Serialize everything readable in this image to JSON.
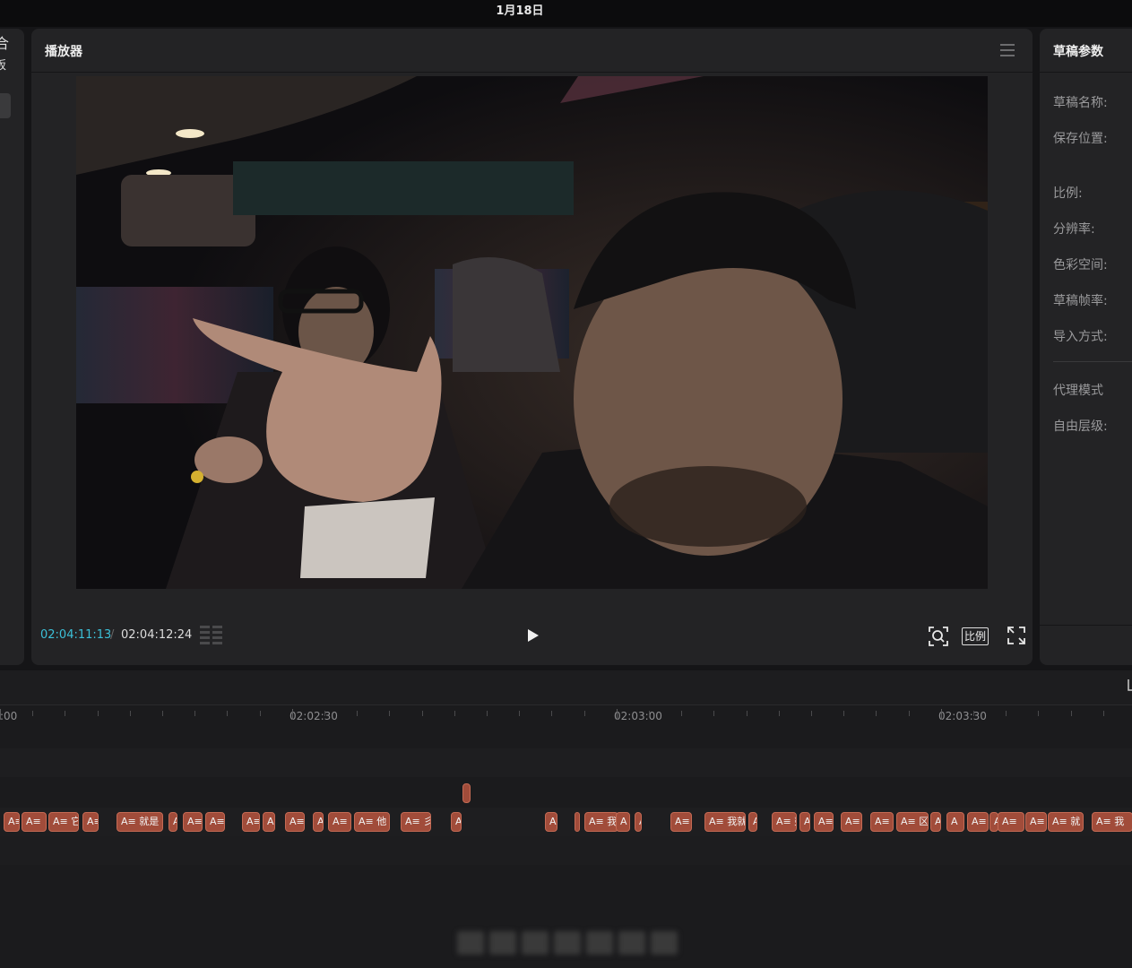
{
  "topbar": {
    "date": "1月18日"
  },
  "left_panel": {
    "glyph": "合",
    "label": "板"
  },
  "player": {
    "title": "播放器",
    "current_time": "02:04:11:13",
    "separator": "/",
    "total_time": "02:04:12:24",
    "ratio_label": "比例",
    "icons": [
      "menu-icon",
      "grid-icon",
      "play-icon",
      "scan-zoom-icon",
      "ratio-icon",
      "fullscreen-icon"
    ]
  },
  "params": {
    "title": "草稿参数",
    "rows": [
      "草稿名称:",
      "保存位置:",
      "比例:",
      "分辨率:",
      "色彩空间:",
      "草稿帧率:",
      "导入方式:",
      "代理模式",
      "自由层级:"
    ]
  },
  "timeline": {
    "ruler_labels": [
      ":00",
      "02:02:30",
      "02:03:00",
      "02:03:30"
    ],
    "clips": [
      "A≡",
      "A≡",
      "A≡ 它",
      "A≡",
      "A≡ 就是",
      "A",
      "A≡",
      "A≡",
      "A≡",
      "A",
      "A≡",
      "A",
      "A≡",
      "A≡ 他",
      "A≡ 彡",
      "A",
      "A",
      "A",
      "A≡ 我",
      "A",
      "A",
      "A≡",
      "A≡ 我就",
      "A",
      "A≡ 彭",
      "A",
      "A≡",
      "A≡",
      "A≡",
      "A≡ 区",
      "A",
      "A",
      "A≡",
      "A",
      "A≡",
      "A≡",
      "A≡ 就",
      "A≡ 我"
    ],
    "colors": {
      "clip": "#a14c3a",
      "timecode": "#3cc0d8"
    }
  }
}
